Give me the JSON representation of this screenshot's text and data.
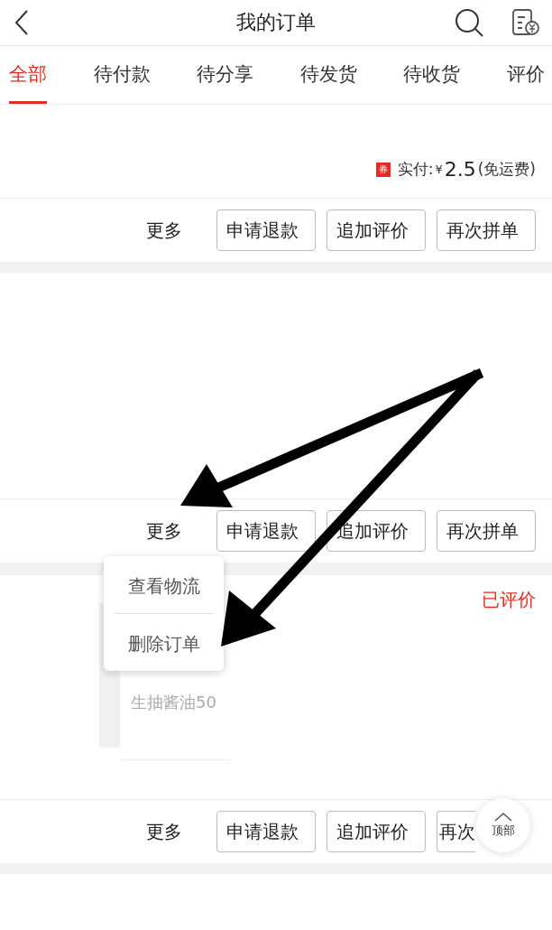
{
  "header": {
    "title": "我的订单"
  },
  "tabs": [
    {
      "label": "全部",
      "selected": true
    },
    {
      "label": "待付款",
      "selected": false
    },
    {
      "label": "待分享",
      "selected": false
    },
    {
      "label": "待发货",
      "selected": false
    },
    {
      "label": "待收货",
      "selected": false
    },
    {
      "label": "评价",
      "selected": false
    }
  ],
  "orders": [
    {
      "payment": {
        "coupon": "券",
        "label": "实付:",
        "currency": "¥",
        "amount": "2.5",
        "note": "(免运费)"
      },
      "more": "更多",
      "actions": [
        "申请退款",
        "追加评价",
        "再次拼单"
      ]
    },
    {
      "more": "更多",
      "actions": [
        "申请退款",
        "追加评价",
        "再次拼单"
      ]
    },
    {
      "status": "已评价",
      "product_title": "生抽酱油50",
      "more": "更多",
      "actions": [
        "申请退款",
        "追加评价",
        "再次"
      ]
    }
  ],
  "popup_menu": {
    "items": [
      "查看物流",
      "删除订单"
    ]
  },
  "back_to_top": {
    "label": "顶部"
  }
}
